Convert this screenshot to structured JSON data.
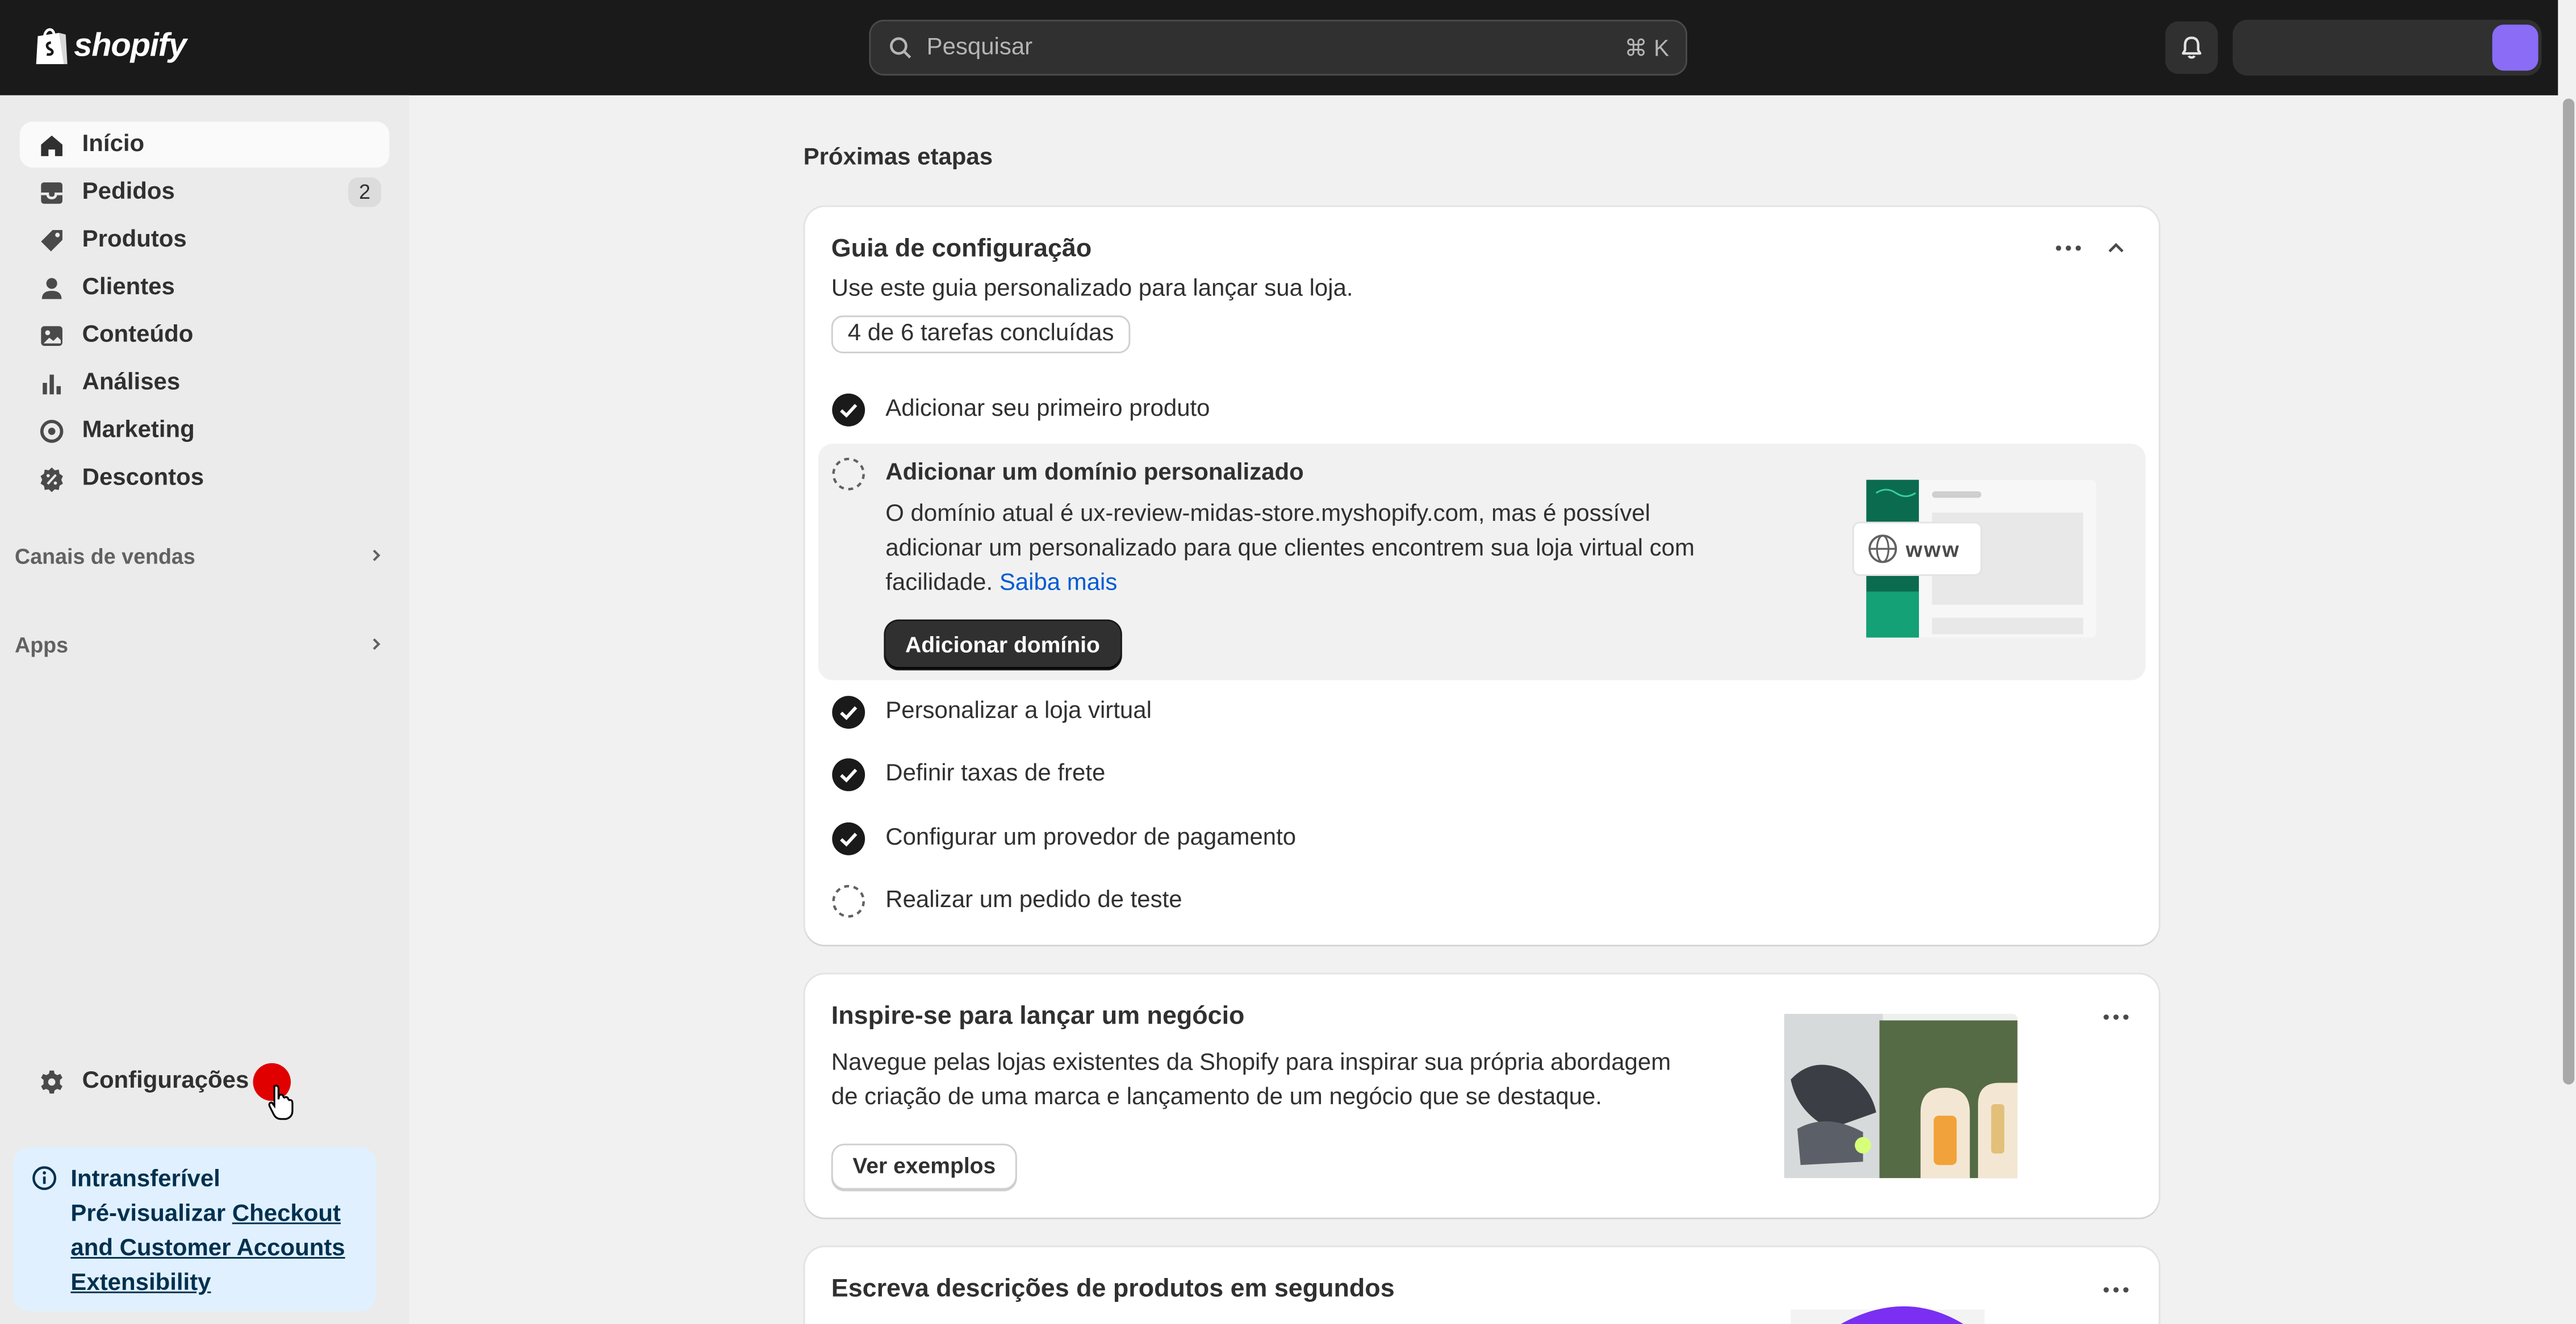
{
  "topbar": {
    "logo_text": "shopify",
    "search_placeholder": "Pesquisar",
    "search_shortcut": "⌘ K",
    "icons": [
      "shopify-bag-icon",
      "search-icon",
      "bell-icon"
    ],
    "avatar_color": "#8a6cf7"
  },
  "sidebar": {
    "items": [
      {
        "label": "Início",
        "icon": "home-icon",
        "active": true
      },
      {
        "label": "Pedidos",
        "icon": "inbox-icon",
        "count": "2"
      },
      {
        "label": "Produtos",
        "icon": "tag-icon"
      },
      {
        "label": "Clientes",
        "icon": "person-icon"
      },
      {
        "label": "Conteúdo",
        "icon": "image-icon"
      },
      {
        "label": "Análises",
        "icon": "bar-chart-icon"
      },
      {
        "label": "Marketing",
        "icon": "target-icon"
      },
      {
        "label": "Descontos",
        "icon": "discount-icon"
      }
    ],
    "sections": [
      {
        "label": "Canais de vendas"
      },
      {
        "label": "Apps"
      }
    ],
    "settings_label": "Configurações",
    "banner": {
      "title": "Intransferível",
      "text": "Pré-visualizar ",
      "link": "Checkout and Customer Accounts Extensibility"
    }
  },
  "main": {
    "heading": "Próximas etapas",
    "setup": {
      "title": "Guia de configuração",
      "subtitle": "Use este guia personalizado para lançar sua loja.",
      "progress": "4 de 6 tarefas concluídas",
      "tasks": [
        {
          "label": "Adicionar seu primeiro produto",
          "done": true
        },
        {
          "label": "Adicionar um domínio personalizado",
          "done": false
        },
        {
          "label": "Personalizar a loja virtual",
          "done": true
        },
        {
          "label": "Definir taxas de frete",
          "done": true
        },
        {
          "label": "Configurar um provedor de pagamento",
          "done": true
        },
        {
          "label": "Realizar um pedido de teste",
          "done": false
        }
      ],
      "expanded": {
        "description": "O domínio atual é ux-review-midas-store.myshopify.com, mas é possível adicionar um personalizado para que clientes encontrem sua loja virtual com facilidade. ",
        "link": "Saiba mais",
        "button": "Adicionar domínio",
        "illustration_text": "www"
      }
    },
    "inspire": {
      "title": "Inspire-se para lançar um negócio",
      "text": "Navegue pelas lojas existentes da Shopify para inspirar sua própria abordagem de criação de uma marca e lançamento de um negócio que se destaque.",
      "button": "Ver exemplos"
    },
    "describe": {
      "title": "Escreva descrições de produtos em segundos"
    }
  }
}
